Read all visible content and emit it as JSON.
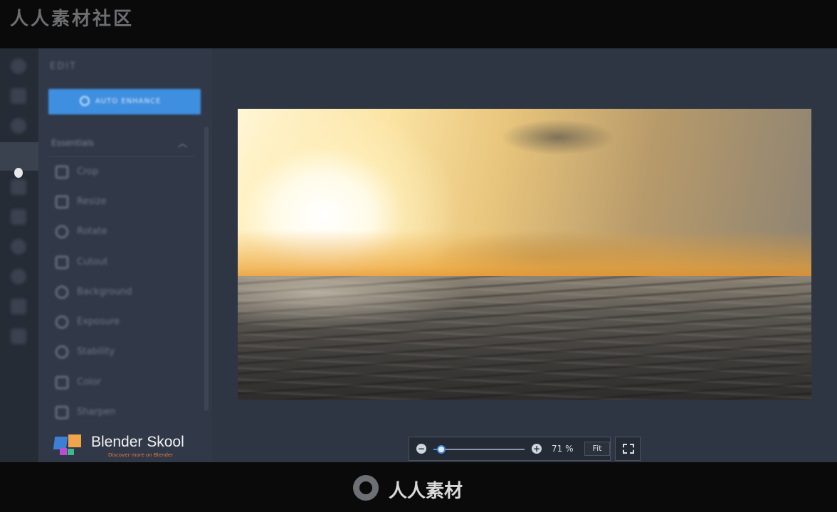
{
  "watermark": {
    "top": "人人素材社区",
    "bottom": "人人素材"
  },
  "panel": {
    "title": "EDIT",
    "auto_enhance": "AUTO ENHANCE",
    "section": "Essentials",
    "tools": [
      "Crop",
      "Resize",
      "Rotate",
      "Cutout",
      "Background",
      "Exposure",
      "Stability",
      "Color",
      "Sharpen"
    ]
  },
  "brand": {
    "name": "Blender Skool",
    "tagline": "Discover more on Blender"
  },
  "zoom": {
    "percent_label": "71 %",
    "fit_label": "Fit",
    "zoom_out": "−",
    "zoom_in": "+",
    "level": 0.71
  },
  "colors": {
    "accent": "#3f8fe0",
    "panel": "#313948",
    "canvas": "#2f3643"
  }
}
